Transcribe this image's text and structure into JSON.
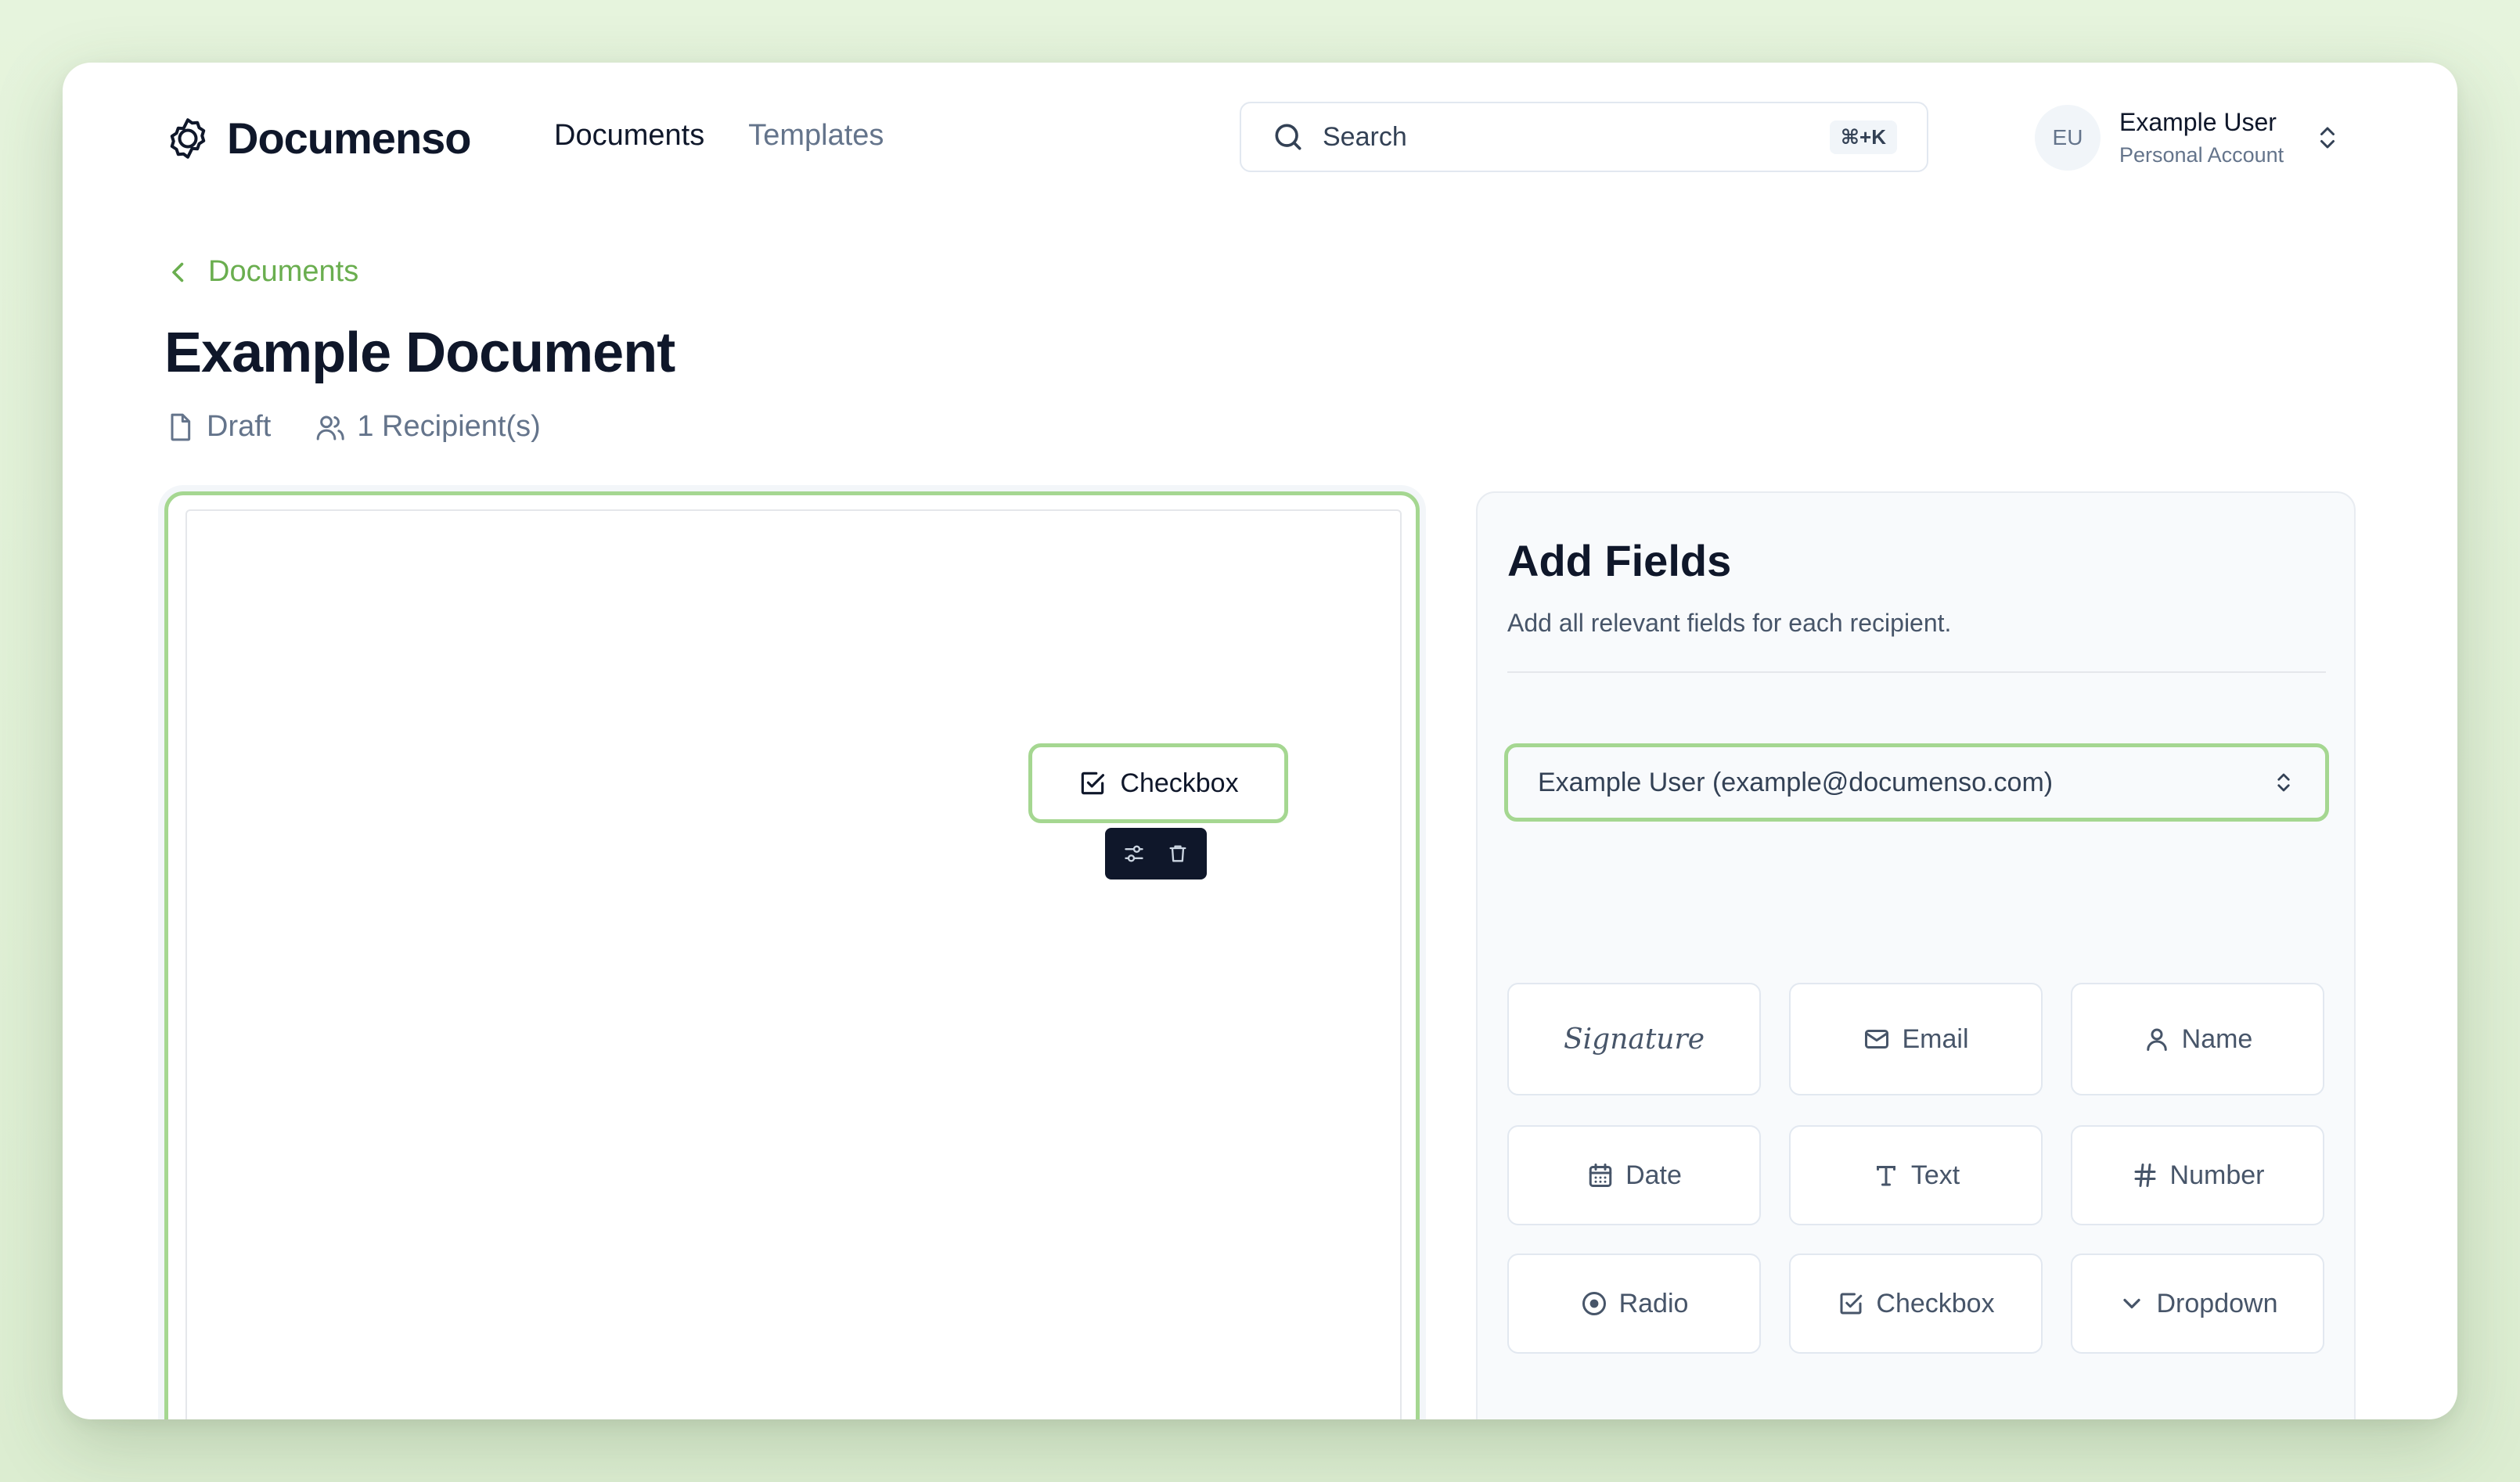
{
  "header": {
    "logo_text": "Documenso",
    "nav": [
      {
        "label": "Documents",
        "active": true
      },
      {
        "label": "Templates",
        "active": false
      }
    ],
    "search": {
      "placeholder": "Search",
      "shortcut": "⌘+K"
    },
    "user": {
      "initials": "EU",
      "name": "Example User",
      "account": "Personal Account"
    }
  },
  "breadcrumb": {
    "label": "Documents"
  },
  "document": {
    "title": "Example Document",
    "status": "Draft",
    "recipients": "1 Recipient(s)"
  },
  "canvas": {
    "placed_field": {
      "label": "Checkbox"
    }
  },
  "panel": {
    "title": "Add Fields",
    "subtitle": "Add all relevant fields for each recipient.",
    "recipient_select": "Example User (example@documenso.com)",
    "fields": [
      {
        "label": "Signature",
        "icon": "signature-icon"
      },
      {
        "label": "Email",
        "icon": "mail-icon"
      },
      {
        "label": "Name",
        "icon": "user-icon"
      },
      {
        "label": "Date",
        "icon": "calendar-icon"
      },
      {
        "label": "Text",
        "icon": "type-icon"
      },
      {
        "label": "Number",
        "icon": "hash-icon"
      },
      {
        "label": "Radio",
        "icon": "radio-icon"
      },
      {
        "label": "Checkbox",
        "icon": "checkbox-icon"
      },
      {
        "label": "Dropdown",
        "icon": "chevron-down-icon"
      }
    ]
  },
  "colors": {
    "accent": "#a5d791",
    "link": "#6aae4f",
    "text": "#0f172a",
    "muted": "#64748b",
    "background": "#e3f2da"
  }
}
